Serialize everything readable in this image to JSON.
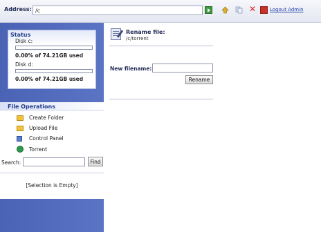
{
  "address": {
    "label": "Address:",
    "value": "/c"
  },
  "toolbar": {
    "logout_label": "Logout Admin"
  },
  "status": {
    "title": "Status",
    "disks": [
      {
        "label": "Disk c:",
        "usage_text": "0.00% of 74.21GB used",
        "used_fraction": 0.0
      },
      {
        "label": "Disk d:",
        "usage_text": "0.00% of 74.21GB used",
        "used_fraction": 0.0
      }
    ]
  },
  "file_operations": {
    "title": "File Operations",
    "items": [
      {
        "label": "Create Folder",
        "icon": "folder-icon"
      },
      {
        "label": "Upload File",
        "icon": "upload-icon"
      },
      {
        "label": "Control Panel",
        "icon": "control-panel-icon"
      },
      {
        "label": "Torrent",
        "icon": "torrent-icon"
      }
    ],
    "search_label": "Search:",
    "search_value": "",
    "find_label": "Find"
  },
  "selection": {
    "text": "[Selection is Empty]"
  },
  "rename": {
    "title": "Rename file:",
    "path": "/c/torrent",
    "new_filename_label": "New filename:",
    "new_filename_value": "",
    "button_label": "Rename"
  }
}
